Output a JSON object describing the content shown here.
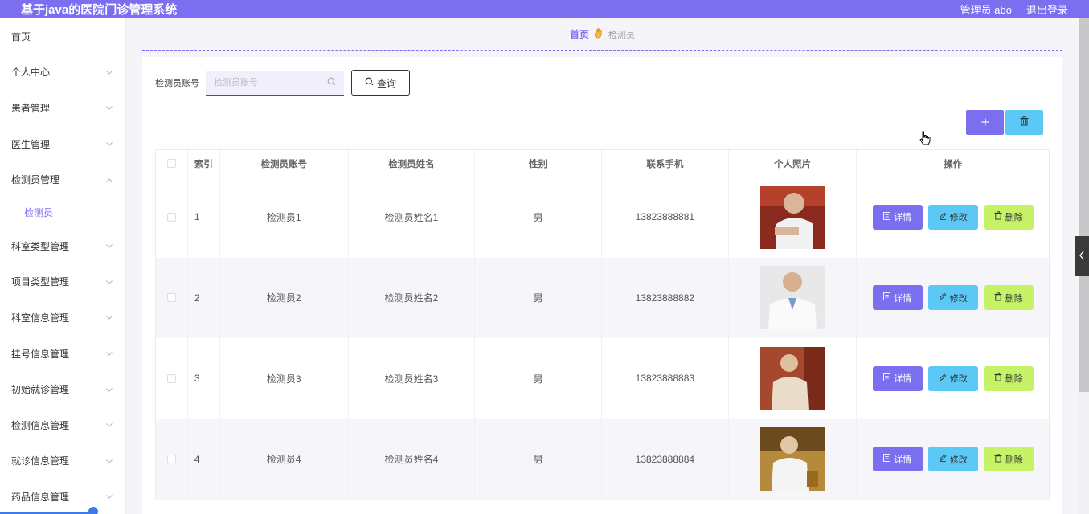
{
  "header": {
    "app_title": "基于java的医院门诊管理系统",
    "user_label": "管理员 abo",
    "logout_label": "退出登录"
  },
  "sidebar": {
    "items": [
      {
        "label": "首页",
        "chevron": ""
      },
      {
        "label": "个人中心",
        "chevron": "down"
      },
      {
        "label": "患者管理",
        "chevron": "down"
      },
      {
        "label": "医生管理",
        "chevron": "down"
      },
      {
        "label": "检测员管理",
        "chevron": "up"
      },
      {
        "label": "检测员",
        "chevron": "",
        "sub": true,
        "active": true
      },
      {
        "label": "科室类型管理",
        "chevron": "down"
      },
      {
        "label": "项目类型管理",
        "chevron": "down"
      },
      {
        "label": "科室信息管理",
        "chevron": "down"
      },
      {
        "label": "挂号信息管理",
        "chevron": "down"
      },
      {
        "label": "初始就诊管理",
        "chevron": "down"
      },
      {
        "label": "检测信息管理",
        "chevron": "down"
      },
      {
        "label": "就诊信息管理",
        "chevron": "down"
      },
      {
        "label": "药品信息管理",
        "chevron": "down"
      }
    ]
  },
  "breadcrumb": {
    "home": "首页",
    "current": "检测员"
  },
  "search": {
    "label": "检测员账号",
    "placeholder": "检测员账号",
    "value": "",
    "button_label": "查询"
  },
  "table": {
    "columns": [
      "索引",
      "检测员账号",
      "检测员姓名",
      "性别",
      "联系手机",
      "个人照片",
      "操作"
    ],
    "rows": [
      {
        "index": "1",
        "account": "检测员1",
        "name": "检测员姓名1",
        "gender": "男",
        "phone": "13823888881"
      },
      {
        "index": "2",
        "account": "检测员2",
        "name": "检测员姓名2",
        "gender": "男",
        "phone": "13823888882"
      },
      {
        "index": "3",
        "account": "检测员3",
        "name": "检测员姓名3",
        "gender": "男",
        "phone": "13823888883"
      },
      {
        "index": "4",
        "account": "检测员4",
        "name": "检测员姓名4",
        "gender": "男",
        "phone": "13823888884"
      }
    ],
    "actions": {
      "detail": "详情",
      "edit": "修改",
      "delete": "删除"
    }
  },
  "colors": {
    "accent": "#7b6ff0",
    "edit": "#5bc8f5",
    "delete": "#c5f266"
  }
}
